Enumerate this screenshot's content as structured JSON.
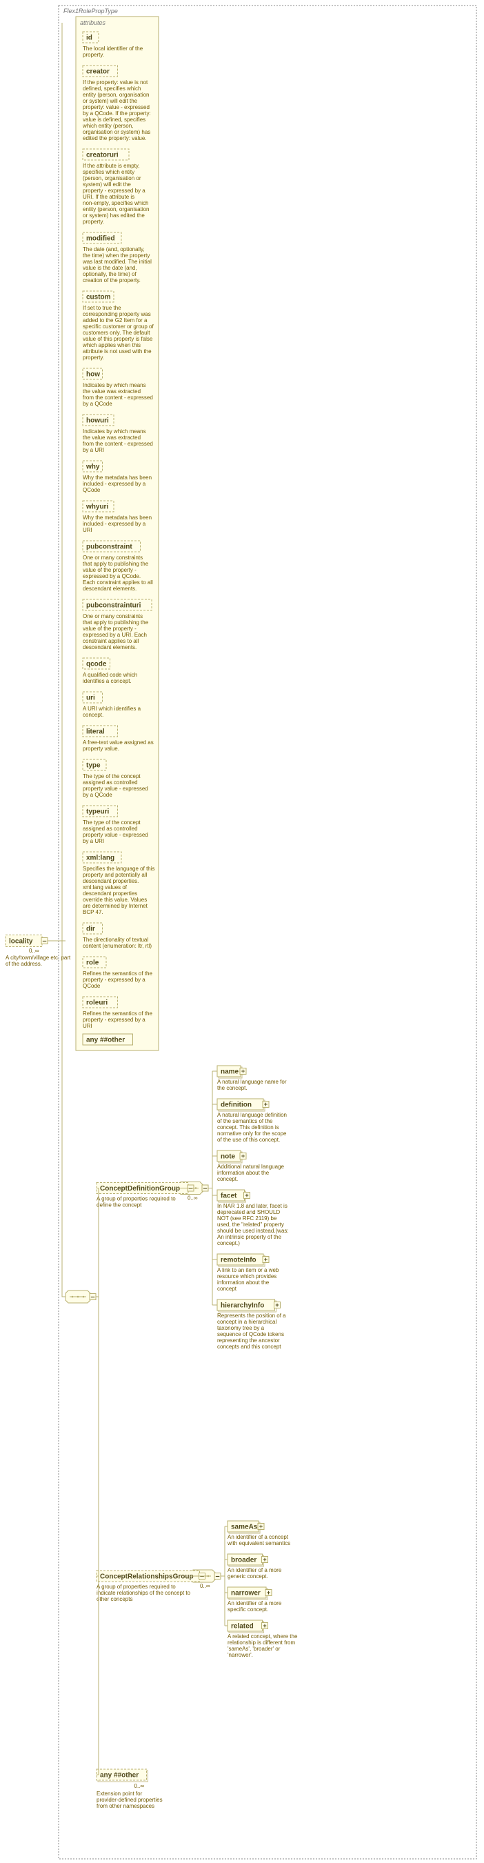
{
  "outer_label": "Flex1RolePropType",
  "attributes_label": "attributes",
  "locality": {
    "label": "locality",
    "occ": "0..∞",
    "desc": [
      "A city/town/village etc. part",
      "of the address."
    ]
  },
  "attrs": [
    {
      "name": "id",
      "desc": [
        "The local identifier of the",
        "property."
      ]
    },
    {
      "name": "creator",
      "desc": [
        "If the property: value is not",
        "defined, specifies which",
        "entity (person, organisation",
        "or system) will edit the",
        "property: value - expressed",
        "by a QCode. If the property:",
        "value is defined, specifies",
        "which entity (person,",
        "organisation or system) has",
        "edited the property: value."
      ]
    },
    {
      "name": "creatoruri",
      "desc": [
        "If the attribute is empty,",
        "specifies which entity",
        "(person, organisation or",
        "system) will edit the",
        "property - expressed by a",
        "URI. If the attribute is",
        "non-empty, specifies which",
        "entity (person, organisation",
        "or system) has edited the",
        "property."
      ]
    },
    {
      "name": "modified",
      "desc": [
        "The date (and, optionally,",
        "the time) when the property",
        "was last modified. The initial",
        "value is the date (and,",
        "optionally, the time) of",
        "creation of the property."
      ]
    },
    {
      "name": "custom",
      "desc": [
        "If set to true the",
        "corresponding property was",
        "added to the G2 Item for a",
        "specific customer or group of",
        "customers only. The default",
        "value of this property is false",
        "which applies when this",
        "attribute is not used with the",
        "property."
      ]
    },
    {
      "name": "how",
      "desc": [
        "Indicates by which means",
        "the value was extracted",
        "from the content - expressed",
        "by a QCode"
      ]
    },
    {
      "name": "howuri",
      "desc": [
        "Indicates by which means",
        "the value was extracted",
        "from the content - expressed",
        "by a URI"
      ]
    },
    {
      "name": "why",
      "desc": [
        "Why the metadata has been",
        "included - expressed by a",
        "QCode"
      ]
    },
    {
      "name": "whyuri",
      "desc": [
        "Why the metadata has been",
        "included - expressed by a",
        "URI"
      ]
    },
    {
      "name": "pubconstraint",
      "desc": [
        "One or many constraints",
        "that apply to publishing the",
        "value of the property -",
        "expressed by a QCode.",
        "Each constraint applies to all",
        "descendant elements."
      ]
    },
    {
      "name": "pubconstrainturi",
      "desc": [
        "One or many constraints",
        "that apply to publishing the",
        "value of the property -",
        "expressed by a URI. Each",
        "constraint applies to all",
        "descendant elements."
      ]
    },
    {
      "name": "qcode",
      "desc": [
        "A qualified code which",
        "identifies a concept."
      ]
    },
    {
      "name": "uri",
      "desc": [
        "A URI which identifies a",
        "concept."
      ]
    },
    {
      "name": "literal",
      "desc": [
        "A free-text value assigned as",
        "property value."
      ]
    },
    {
      "name": "type",
      "desc": [
        "The type of the concept",
        "assigned as controlled",
        "property value - expressed",
        "by a QCode"
      ]
    },
    {
      "name": "typeuri",
      "desc": [
        "The type of the concept",
        "assigned as controlled",
        "property value - expressed",
        "by a URI"
      ]
    },
    {
      "name": "xml:lang",
      "desc": [
        "Specifies the language of this",
        "property and potentially all",
        "descendant properties.",
        "xml:lang values of",
        "descendant properties",
        "override this value. Values",
        "are determined by Internet",
        "BCP 47."
      ]
    },
    {
      "name": "dir",
      "desc": [
        "The directionality of textual",
        "content (enumeration: ltr, rtl)"
      ]
    },
    {
      "name": "role",
      "desc": [
        "Refines the semantics of the",
        "property - expressed by a",
        "QCode"
      ]
    },
    {
      "name": "roleuri",
      "desc": [
        "Refines the semantics of the",
        "property - expressed by a",
        "URI"
      ]
    }
  ],
  "any_other_attr": {
    "label": "any ##other"
  },
  "group1": {
    "label": "ConceptDefinitionGroup",
    "desc": [
      "A group of properties required to",
      "define the concept"
    ],
    "seq_occ": "0..∞",
    "children": [
      {
        "name": "name",
        "desc": [
          "A natural language name for",
          "the concept."
        ]
      },
      {
        "name": "definition",
        "desc": [
          "A natural language definition",
          "of the semantics of the",
          "concept. This definition is",
          "normative only for the scope",
          "of the use of this concept."
        ]
      },
      {
        "name": "note",
        "desc": [
          "Additional natural language",
          "information about the",
          "concept."
        ]
      },
      {
        "name": "facet",
        "desc": [
          "In NAR 1.8 and later, facet is",
          "deprecated and SHOULD",
          "NOT (see RFC 2119) be",
          "used, the \"related\" property",
          "should be used instead.(was:",
          "An intrinsic property of the",
          "concept.)"
        ]
      },
      {
        "name": "remoteInfo",
        "desc": [
          "A link to an item or a web",
          "resource which provides",
          "information about the",
          "concept"
        ]
      },
      {
        "name": "hierarchyInfo",
        "desc": [
          "Represents the position of a",
          "concept in a hierarchical",
          "taxonomy tree by a",
          "sequence of QCode tokens",
          "representing the ancestor",
          "concepts and this concept"
        ]
      }
    ]
  },
  "group2": {
    "label": "ConceptRelationshipsGroup",
    "desc": [
      "A group of properties required to",
      "indicate relationships of the concept to",
      "other concepts"
    ],
    "seq_occ": "0..∞",
    "children": [
      {
        "name": "sameAs",
        "desc": [
          "An identifier of a concept",
          "with equivalent semantics"
        ]
      },
      {
        "name": "broader",
        "desc": [
          "An identifier of a more",
          "generic concept."
        ]
      },
      {
        "name": "narrower",
        "desc": [
          "An identifier of a more",
          "specific concept."
        ]
      },
      {
        "name": "related",
        "desc": [
          "A related concept, where the",
          "relationship is different from",
          "'sameAs', 'broader' or",
          "'narrower'."
        ]
      }
    ]
  },
  "any_elem": {
    "label": "any ##other",
    "occ": "0..∞",
    "desc": [
      "Extension point for",
      "provider-defined properties",
      "from other namespaces"
    ]
  }
}
